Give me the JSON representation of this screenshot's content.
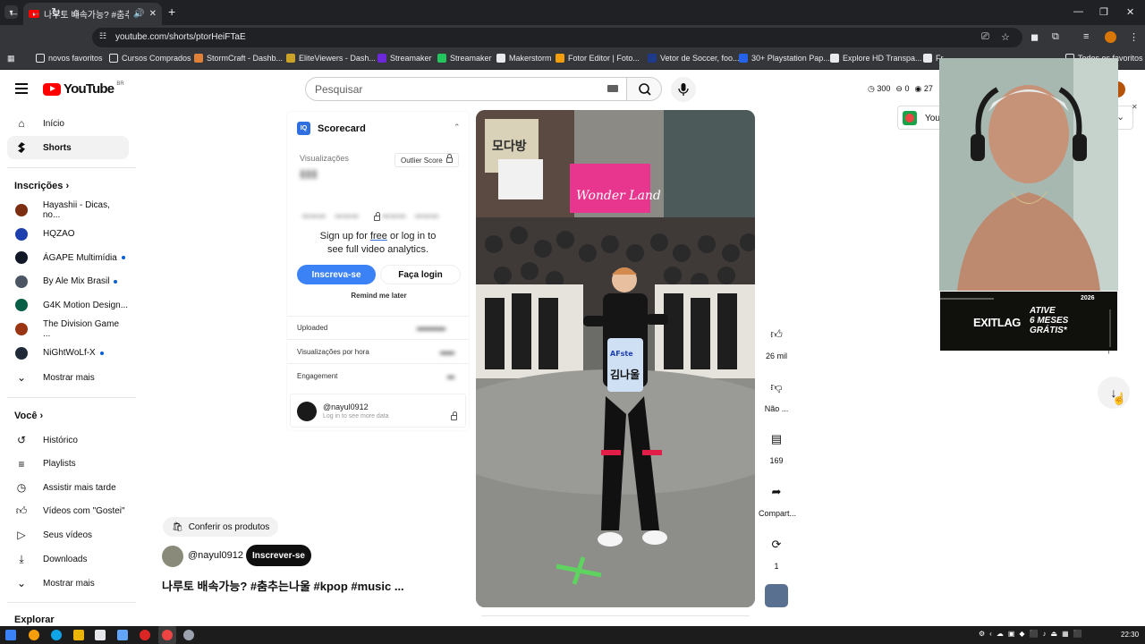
{
  "browser": {
    "tab_title": "나루토 배속가능? #춤추는나",
    "url": "youtube.com/shorts/ptorHeiFTaE",
    "bookmarks": [
      {
        "label": "novos favoritos",
        "icon": "folder-icon",
        "color": "#e8eaed"
      },
      {
        "label": "Cursos Comprados",
        "icon": "folder-icon",
        "color": "#e8eaed"
      },
      {
        "label": "StormCraft - Dashb...",
        "icon": "stormcraft-icon",
        "color": "#e0813a"
      },
      {
        "label": "EliteViewers - Dash...",
        "icon": "eliteviewers-icon",
        "color": "#c9a227"
      },
      {
        "label": "Streamaker",
        "icon": "streamaker-icon",
        "color": "#6d28d9"
      },
      {
        "label": "Streamaker",
        "icon": "streamaker-icon",
        "color": "#22c55e"
      },
      {
        "label": "Makerstorm",
        "icon": "makerstorm-icon",
        "color": "#e8eaed"
      },
      {
        "label": "Fotor Editor  |  Foto...",
        "icon": "fotor-icon",
        "color": "#f59e0b"
      },
      {
        "label": "Vetor de Soccer, foo...",
        "icon": "freepik-icon",
        "color": "#1e3a8a"
      },
      {
        "label": "30+ Playstation Pap...",
        "icon": "playstation-icon",
        "color": "#2563eb"
      },
      {
        "label": "Explore HD Transpa...",
        "icon": "pngtree-icon",
        "color": "#e8eaed"
      },
      {
        "label": "Fr...",
        "icon": "bookmark-icon",
        "color": "#e8eaed"
      },
      {
        "label": "Todos os favoritos",
        "icon": "folder-icon",
        "color": "#e8eaed"
      }
    ]
  },
  "youtube": {
    "logo_text": "YouTube",
    "country_code": "BR",
    "search_placeholder": "Pesquisar",
    "counters": [
      "300",
      "0",
      "27"
    ]
  },
  "sidebar": {
    "top": [
      {
        "label": "Início",
        "icon": "home-icon"
      },
      {
        "label": "Shorts",
        "icon": "shorts-icon"
      }
    ],
    "subscriptions_title": "Inscrições",
    "channels": [
      {
        "label": "Hayashii - Dicas, no...",
        "color": "#7c2d12",
        "dot": false
      },
      {
        "label": "HQZAO",
        "color": "#1e40af",
        "dot": false
      },
      {
        "label": "ÁGAPE Multimídia",
        "color": "#111827",
        "dot": true
      },
      {
        "label": "By Ale Mix Brasil",
        "color": "#4b5563",
        "dot": true
      },
      {
        "label": "G4K Motion Design...",
        "color": "#065f46",
        "dot": false
      },
      {
        "label": "The Division Game ...",
        "color": "#9a3412",
        "dot": false
      },
      {
        "label": "NiGhtWoLf-X",
        "color": "#1f2937",
        "dot": true
      }
    ],
    "show_more": "Mostrar mais",
    "you_title": "Você",
    "you_items": [
      {
        "label": "Histórico",
        "icon": "history-icon"
      },
      {
        "label": "Playlists",
        "icon": "playlist-icon"
      },
      {
        "label": "Assistir mais tarde",
        "icon": "clock-icon"
      },
      {
        "label": "Vídeos com \"Gostei\"",
        "icon": "like-icon"
      },
      {
        "label": "Seus vídeos",
        "icon": "video-icon"
      },
      {
        "label": "Downloads",
        "icon": "download-icon"
      }
    ],
    "show_more_2": "Mostrar mais",
    "explore_title": "Explorar"
  },
  "scorecard": {
    "title": "Scorecard",
    "views_label": "Visualizações",
    "outlier_label": "Outlier Score",
    "signup_pre": "Sign up for ",
    "signup_free": "free",
    "signup_post": " or log in to see full video analytics.",
    "subscribe_btn": "Inscreva-se",
    "login_btn": "Faça login",
    "remind": "Remind me later",
    "rows": [
      "Uploaded",
      "Visualizações por hora",
      "Engagement"
    ],
    "account": "@nayul0912",
    "account_sub": "Log in to see more data"
  },
  "short": {
    "products_label": "Conferir os produtos",
    "channel": "@nayul0912",
    "subscribe": "Inscrever-se",
    "title": "나루토 배속가능? #춤추는나울 #kpop #music ...",
    "video_text_sign1": "모다방",
    "video_text_sign2": "Wonder Land",
    "video_text_bib": "AFste 김나울"
  },
  "actions": [
    {
      "label": "26 mil",
      "icon": "thumbs-up-icon"
    },
    {
      "label": "Não ...",
      "icon": "thumbs-down-icon"
    },
    {
      "label": "169",
      "icon": "comment-icon"
    },
    {
      "label": "Compart...",
      "icon": "share-icon"
    },
    {
      "label": "1",
      "icon": "remix-icon"
    }
  ],
  "extension_chip": "You",
  "ad": {
    "brand": "EXITLAG",
    "line1": "ATIVE",
    "line2": "6 MESES",
    "line3": "GRÁTIS*",
    "year": "2026"
  },
  "taskbar": {
    "time": "22:30"
  }
}
